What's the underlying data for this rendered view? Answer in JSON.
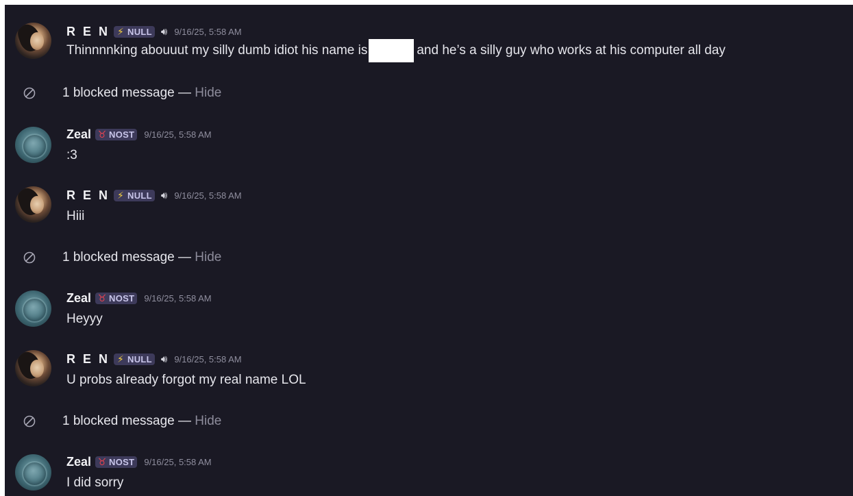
{
  "messages": [
    {
      "type": "message",
      "author": "R E N",
      "tag": "NULL",
      "tag_icon": "lightning-icon",
      "speaker": true,
      "timestamp": "9/16/25, 5:58 AM",
      "text_before": "Thinnnnking abouuut my silly dumb idiot his name is",
      "text_after": "and he’s a silly guy who works at his computer all day"
    },
    {
      "type": "blocked",
      "text": "1 blocked message — ",
      "hide": "Hide"
    },
    {
      "type": "message",
      "author": "Zeal",
      "tag": "NOST",
      "tag_icon": "horns-icon",
      "timestamp": "9/16/25, 5:58 AM",
      "text": ":3"
    },
    {
      "type": "message",
      "author": "R E N",
      "tag": "NULL",
      "tag_icon": "lightning-icon",
      "speaker": true,
      "timestamp": "9/16/25, 5:58 AM",
      "text": "Hiii"
    },
    {
      "type": "blocked",
      "text": "1 blocked message — ",
      "hide": "Hide"
    },
    {
      "type": "message",
      "author": "Zeal",
      "tag": "NOST",
      "tag_icon": "horns-icon",
      "timestamp": "9/16/25, 5:58 AM",
      "text": "Heyyy"
    },
    {
      "type": "message",
      "author": "R E N",
      "tag": "NULL",
      "tag_icon": "lightning-icon",
      "speaker": true,
      "timestamp": "9/16/25, 5:58 AM",
      "text": "U probs already forgot my real name LOL"
    },
    {
      "type": "blocked",
      "text": "1 blocked message — ",
      "hide": "Hide"
    },
    {
      "type": "message",
      "author": "Zeal",
      "tag": "NOST",
      "tag_icon": "horns-icon",
      "timestamp": "9/16/25, 5:58 AM",
      "text": "I did sorry"
    }
  ],
  "colors": {
    "background": "#1a1924",
    "tag_background": "#3d3a5a",
    "lightning": "#f4d03f",
    "horns": "#e8434f"
  }
}
